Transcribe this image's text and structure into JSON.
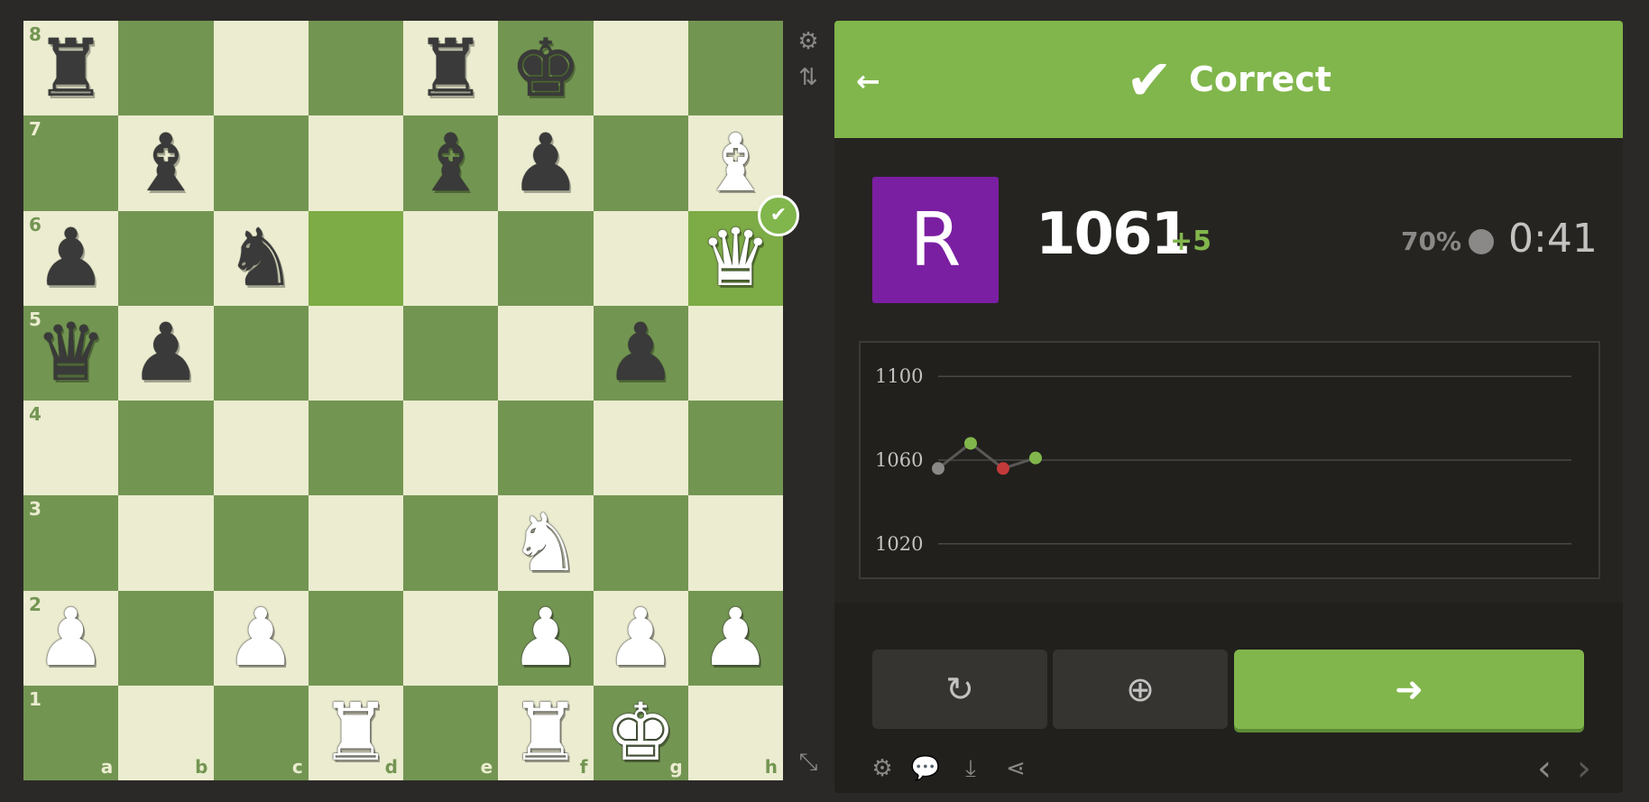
{
  "board": {
    "ranks": [
      "8",
      "7",
      "6",
      "5",
      "4",
      "3",
      "2",
      "1"
    ],
    "files": [
      "a",
      "b",
      "c",
      "d",
      "e",
      "f",
      "g",
      "h"
    ],
    "pieces": [
      {
        "square": "a8",
        "glyph": "♜",
        "color": "black",
        "name": "black-rook"
      },
      {
        "square": "e8",
        "glyph": "♜",
        "color": "black",
        "name": "black-rook"
      },
      {
        "square": "f8",
        "glyph": "♚",
        "color": "black",
        "name": "black-king"
      },
      {
        "square": "b7",
        "glyph": "♝",
        "color": "black",
        "name": "black-bishop"
      },
      {
        "square": "e7",
        "glyph": "♝",
        "color": "black",
        "name": "black-bishop"
      },
      {
        "square": "f7",
        "glyph": "♟",
        "color": "black",
        "name": "black-pawn"
      },
      {
        "square": "h7",
        "glyph": "♝",
        "color": "white",
        "name": "white-bishop"
      },
      {
        "square": "a6",
        "glyph": "♟",
        "color": "black",
        "name": "black-pawn"
      },
      {
        "square": "c6",
        "glyph": "♞",
        "color": "black",
        "name": "black-knight"
      },
      {
        "square": "h6",
        "glyph": "♛",
        "color": "white",
        "name": "white-queen"
      },
      {
        "square": "a5",
        "glyph": "♛",
        "color": "black",
        "name": "black-queen"
      },
      {
        "square": "b5",
        "glyph": "♟",
        "color": "black",
        "name": "black-pawn"
      },
      {
        "square": "g5",
        "glyph": "♟",
        "color": "black",
        "name": "black-pawn"
      },
      {
        "square": "f3",
        "glyph": "♞",
        "color": "white",
        "name": "white-knight"
      },
      {
        "square": "a2",
        "glyph": "♟",
        "color": "white",
        "name": "white-pawn"
      },
      {
        "square": "c2",
        "glyph": "♟",
        "color": "white",
        "name": "white-pawn"
      },
      {
        "square": "f2",
        "glyph": "♟",
        "color": "white",
        "name": "white-pawn"
      },
      {
        "square": "g2",
        "glyph": "♟",
        "color": "white",
        "name": "white-pawn"
      },
      {
        "square": "h2",
        "glyph": "♟",
        "color": "white",
        "name": "white-pawn"
      },
      {
        "square": "d1",
        "glyph": "♜",
        "color": "white",
        "name": "white-rook"
      },
      {
        "square": "f1",
        "glyph": "♜",
        "color": "white",
        "name": "white-rook"
      },
      {
        "square": "g1",
        "glyph": "♚",
        "color": "white",
        "name": "white-king"
      }
    ],
    "highlighted_squares": [
      "d6",
      "h6"
    ],
    "correct_square": "h6",
    "correct_badge_glyph": "✔",
    "colors": {
      "light": "#ebecd0",
      "dark": "#739552",
      "highlight": "#81b64c"
    }
  },
  "board_tools": {
    "settings_icon": "⚙",
    "flip_icon": "⇅",
    "expand_icon": "⤡"
  },
  "result": {
    "back_icon": "🡐",
    "check_icon": "✔",
    "text": "Correct"
  },
  "player": {
    "avatar_letter": "R",
    "avatar_color": "#7b1fa2",
    "rating": "1061",
    "rating_delta": "+5",
    "accuracy": "70%",
    "timer": "0:41"
  },
  "chart_data": {
    "type": "line",
    "y_ticks": [
      "1100",
      "1060",
      "1020"
    ],
    "ylim": [
      1010,
      1110
    ],
    "x": [
      1,
      2,
      3,
      4
    ],
    "values": [
      1056,
      1068,
      1056,
      1061
    ],
    "point_colors": [
      "#8b8987",
      "#81b64c",
      "#c33a3a",
      "#81b64c"
    ],
    "grid": true
  },
  "actions": {
    "retry_icon": "↻",
    "analysis_icon": "⊕",
    "next_icon": "➜"
  },
  "footer": {
    "settings_icon": "⚙",
    "chat_icon": "💬",
    "download_icon": "⤓",
    "share_icon": "⋖",
    "prev_icon": "‹",
    "next_icon": "›"
  }
}
